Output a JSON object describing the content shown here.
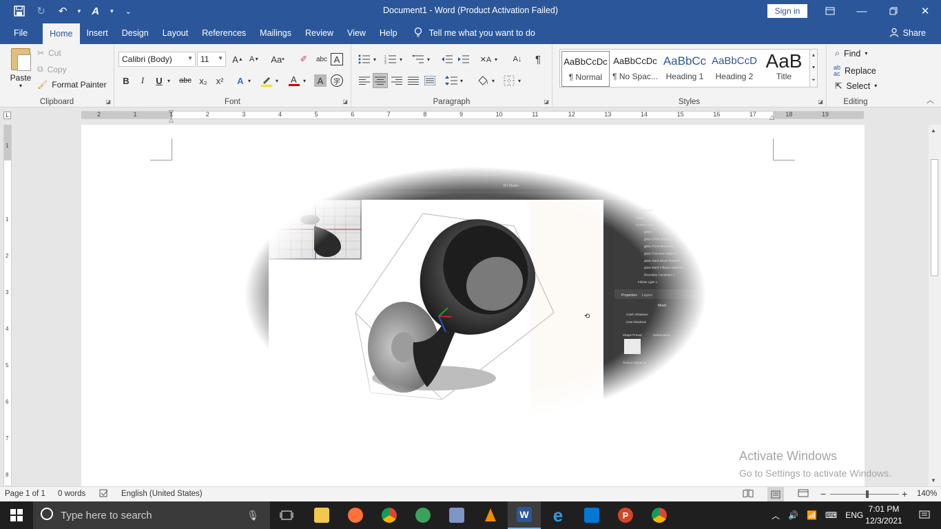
{
  "titlebar": {
    "title": "Document1  -  Word (Product Activation Failed)",
    "sign_in": "Sign in"
  },
  "tabs": [
    "File",
    "Home",
    "Insert",
    "Design",
    "Layout",
    "References",
    "Mailings",
    "Review",
    "View",
    "Help"
  ],
  "tell_me": "Tell me what you want to do",
  "share": "Share",
  "clipboard": {
    "paste": "Paste",
    "cut": "Cut",
    "copy": "Copy",
    "format_painter": "Format Painter",
    "label": "Clipboard"
  },
  "font": {
    "family": "Calibri (Body)",
    "size": "11",
    "label": "Font",
    "grow": "A",
    "shrink": "A",
    "case": "Aa",
    "bold": "B",
    "italic": "I",
    "underline": "U",
    "strike": "abc",
    "subscript": "x₂",
    "superscript": "x²"
  },
  "paragraph": {
    "label": "Paragraph"
  },
  "styles": {
    "label": "Styles",
    "items": [
      {
        "preview": "AaBbCcDc",
        "name": "¶ Normal"
      },
      {
        "preview": "AaBbCcDc",
        "name": "¶ No Spac..."
      },
      {
        "preview": "AaBbCc",
        "name": "Heading 1"
      },
      {
        "preview": "AaBbCcD",
        "name": "Heading 2"
      },
      {
        "preview": "AaB",
        "name": "Title"
      }
    ]
  },
  "editing": {
    "label": "Editing",
    "find": "Find",
    "replace": "Replace",
    "select": "Select"
  },
  "ruler_numbers": [
    "2",
    "1",
    "1",
    "2",
    "3",
    "4",
    "5",
    "6",
    "7",
    "8",
    "9",
    "10",
    "11",
    "12",
    "13",
    "14",
    "15",
    "16",
    "17",
    "18",
    "19"
  ],
  "vruler_numbers": [
    "1",
    "1",
    "2",
    "3",
    "4",
    "5",
    "6",
    "7",
    "8"
  ],
  "embedded": {
    "window_title": "Adobe Photoshop CS6",
    "mode": "3D Mode:",
    "layers": [
      "Environment",
      "Scene",
      "Current View",
      "glass",
      "glass Front Inflation M",
      "glass Front Bevel Mat",
      "glass Extrusion Material",
      "glass Back Bevel Material",
      "glass Back Inflation Material",
      "Boundary Constraint 1",
      "Infinite Light 1"
    ],
    "panel_tabs": [
      "Properties",
      "Layers"
    ],
    "mesh": "Mesh",
    "catch_shadows": "Catch Shadows",
    "cast_shadows": "Cast Shadows",
    "shape_preset": "Shape Preset:",
    "deformation": "Deformation",
    "texture": "Texture Mapping:"
  },
  "watermark": {
    "line1": "Activate Windows",
    "line2": "Go to Settings to activate Windows."
  },
  "status": {
    "page": "Page 1 of 1",
    "words": "0 words",
    "language": "English (United States)",
    "zoom": "140%"
  },
  "taskbar": {
    "search_placeholder": "Type here to search",
    "lang": "ENG",
    "time": "7:01 PM",
    "date": "12/3/2021"
  }
}
